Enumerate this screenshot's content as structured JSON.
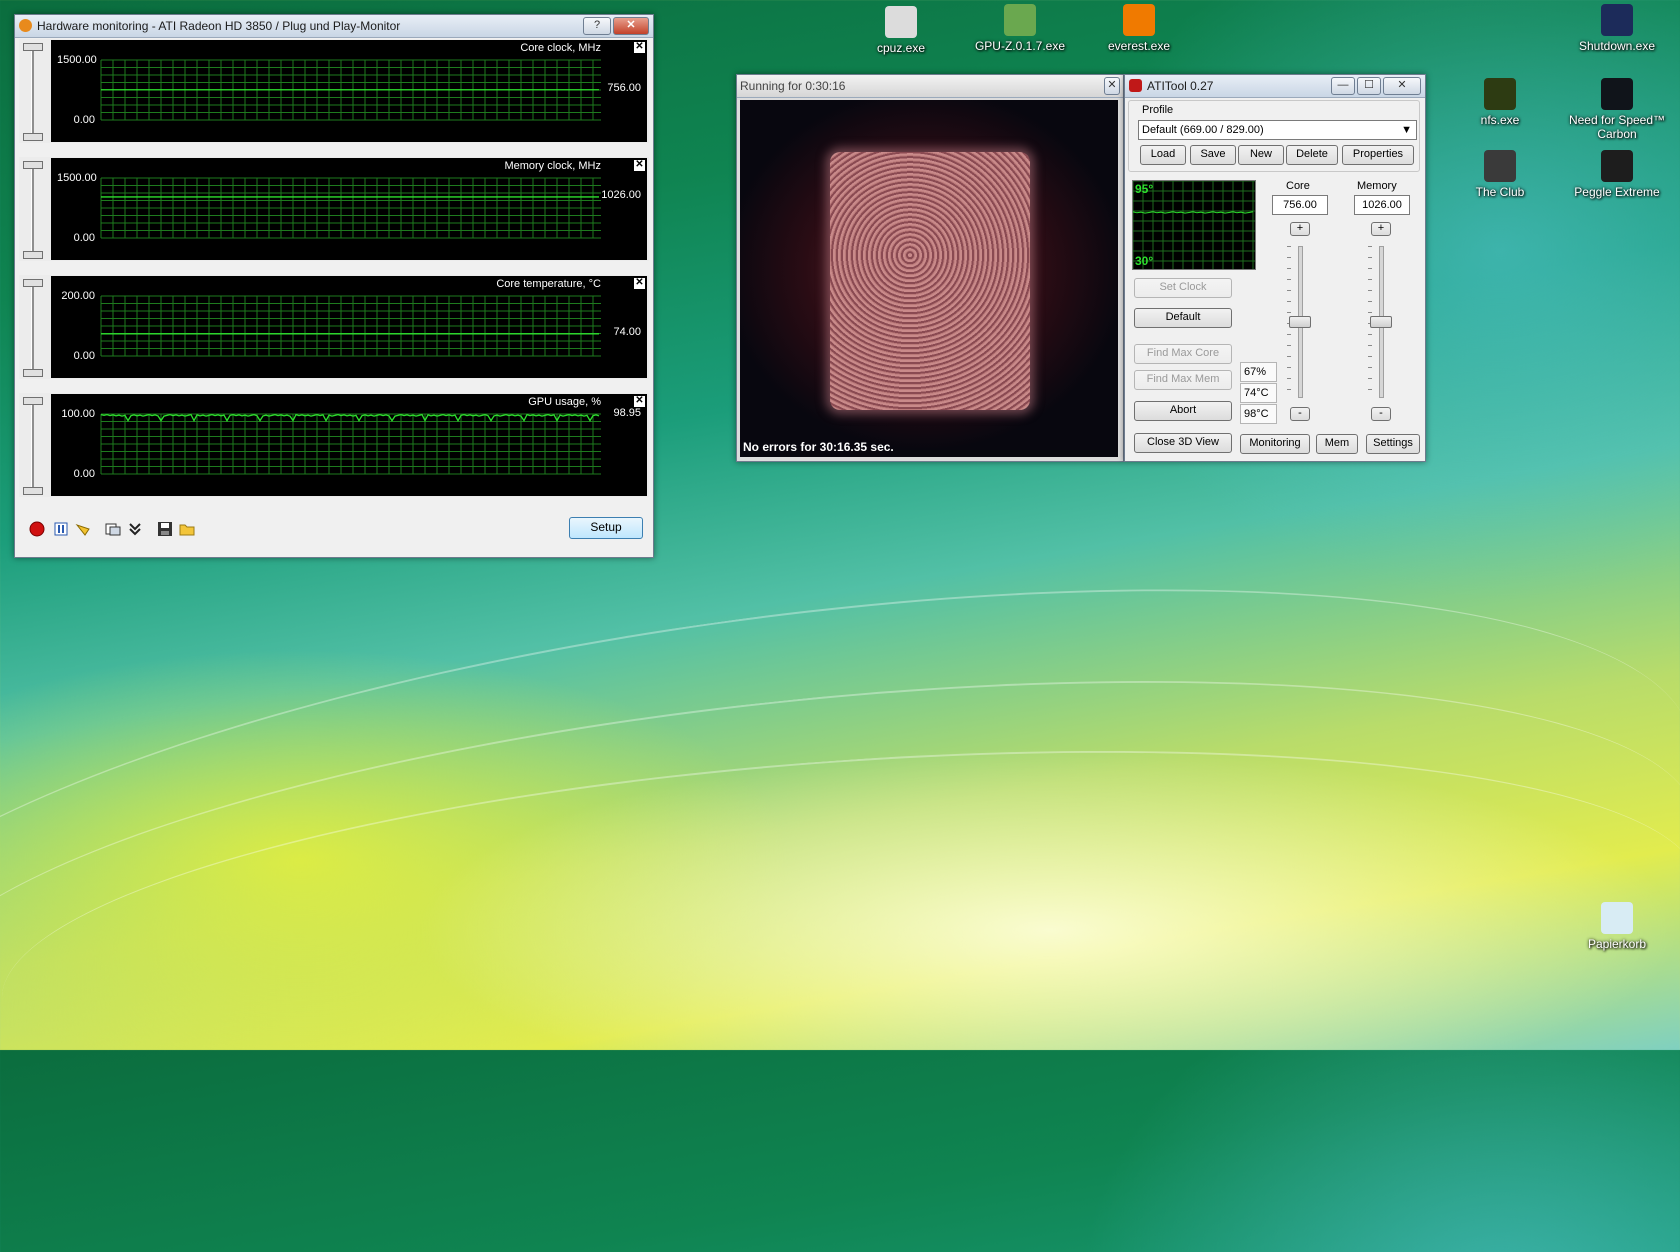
{
  "desktop_icons": [
    {
      "label": "cpuz.exe",
      "icon": "cpuz-icon",
      "color": "#dcdcdc"
    },
    {
      "label": "GPU-Z.0.1.7.exe",
      "icon": "gpuz-icon",
      "color": "#6aa84f"
    },
    {
      "label": "everest.exe",
      "icon": "everest-icon",
      "color": "#f07a00"
    },
    {
      "label": "Shutdown.exe",
      "icon": "shutdown-icon",
      "color": "#1c2b5a"
    },
    {
      "label": "nfs.exe",
      "icon": "nfs-icon",
      "color": "#2d3b12"
    },
    {
      "label": "Need for Speed™ Carbon",
      "icon": "nfs-carbon-icon",
      "color": "#10141a"
    },
    {
      "label": "The Club",
      "icon": "the-club-icon",
      "color": "#3a3a3a"
    },
    {
      "label": "Peggle Extreme",
      "icon": "peggle-icon",
      "color": "#1d1d1d"
    },
    {
      "label": "Papierkorb",
      "icon": "recycle-bin-icon",
      "color": "#d8ecf4"
    }
  ],
  "hw_monitor": {
    "title": "Hardware monitoring - ATI Radeon HD 3850 / Plug und Play-Monitor",
    "help_label": "?",
    "close_label": "✕",
    "graph_close": "✕",
    "setup_label": "Setup",
    "grid_color": "#1e7a1e",
    "line_color": "#2ee02e",
    "graphs": [
      {
        "name": "Core clock, MHz",
        "max": "1500.00",
        "min": "0.00",
        "current": "756.00",
        "level": 0.504
      },
      {
        "name": "Memory clock, MHz",
        "max": "1500.00",
        "min": "0.00",
        "current": "1026.00",
        "level": 0.684
      },
      {
        "name": "Core temperature, °C",
        "max": "200.00",
        "min": "0.00",
        "current": "74.00",
        "level": 0.37
      },
      {
        "name": "GPU usage, %",
        "max": "100.00",
        "min": "0.00",
        "current": "98.95",
        "level": 0.9895
      }
    ],
    "toolbar_icons": [
      "record-icon",
      "pause-icon",
      "wand-icon",
      "copy-icon",
      "collapse-icon",
      "save-icon",
      "folder-icon"
    ]
  },
  "render_window": {
    "title": "Running for 0:30:16",
    "close_label": "✕",
    "status": "No errors for 30:16.35 sec."
  },
  "atitool": {
    "title": "ATITool 0.27",
    "min_label": "—",
    "max_label": "☐",
    "close_label": "✕",
    "profile_label": "Profile",
    "profile_value": "Default (669.00 / 829.00)",
    "buttons": {
      "load": "Load",
      "save": "Save",
      "new": "New",
      "delete": "Delete",
      "properties": "Properties",
      "set_clock": "Set Clock",
      "default": "Default",
      "find_max_core": "Find Max Core",
      "find_max_mem": "Find Max Mem",
      "abort": "Abort",
      "close_3d": "Close 3D View",
      "monitoring": "Monitoring",
      "mem": "Mem",
      "settings": "Settings"
    },
    "temp_graph": {
      "max": "95°",
      "min": "30°",
      "level": 0.65
    },
    "core": {
      "label": "Core",
      "value": "756.00",
      "plus": "+",
      "minus": "-",
      "level": 0.5
    },
    "memory": {
      "label": "Memory",
      "value": "1026.00",
      "plus": "+",
      "minus": "-",
      "level": 0.5
    },
    "stats": [
      "67%",
      "74°C",
      "98°C"
    ]
  }
}
